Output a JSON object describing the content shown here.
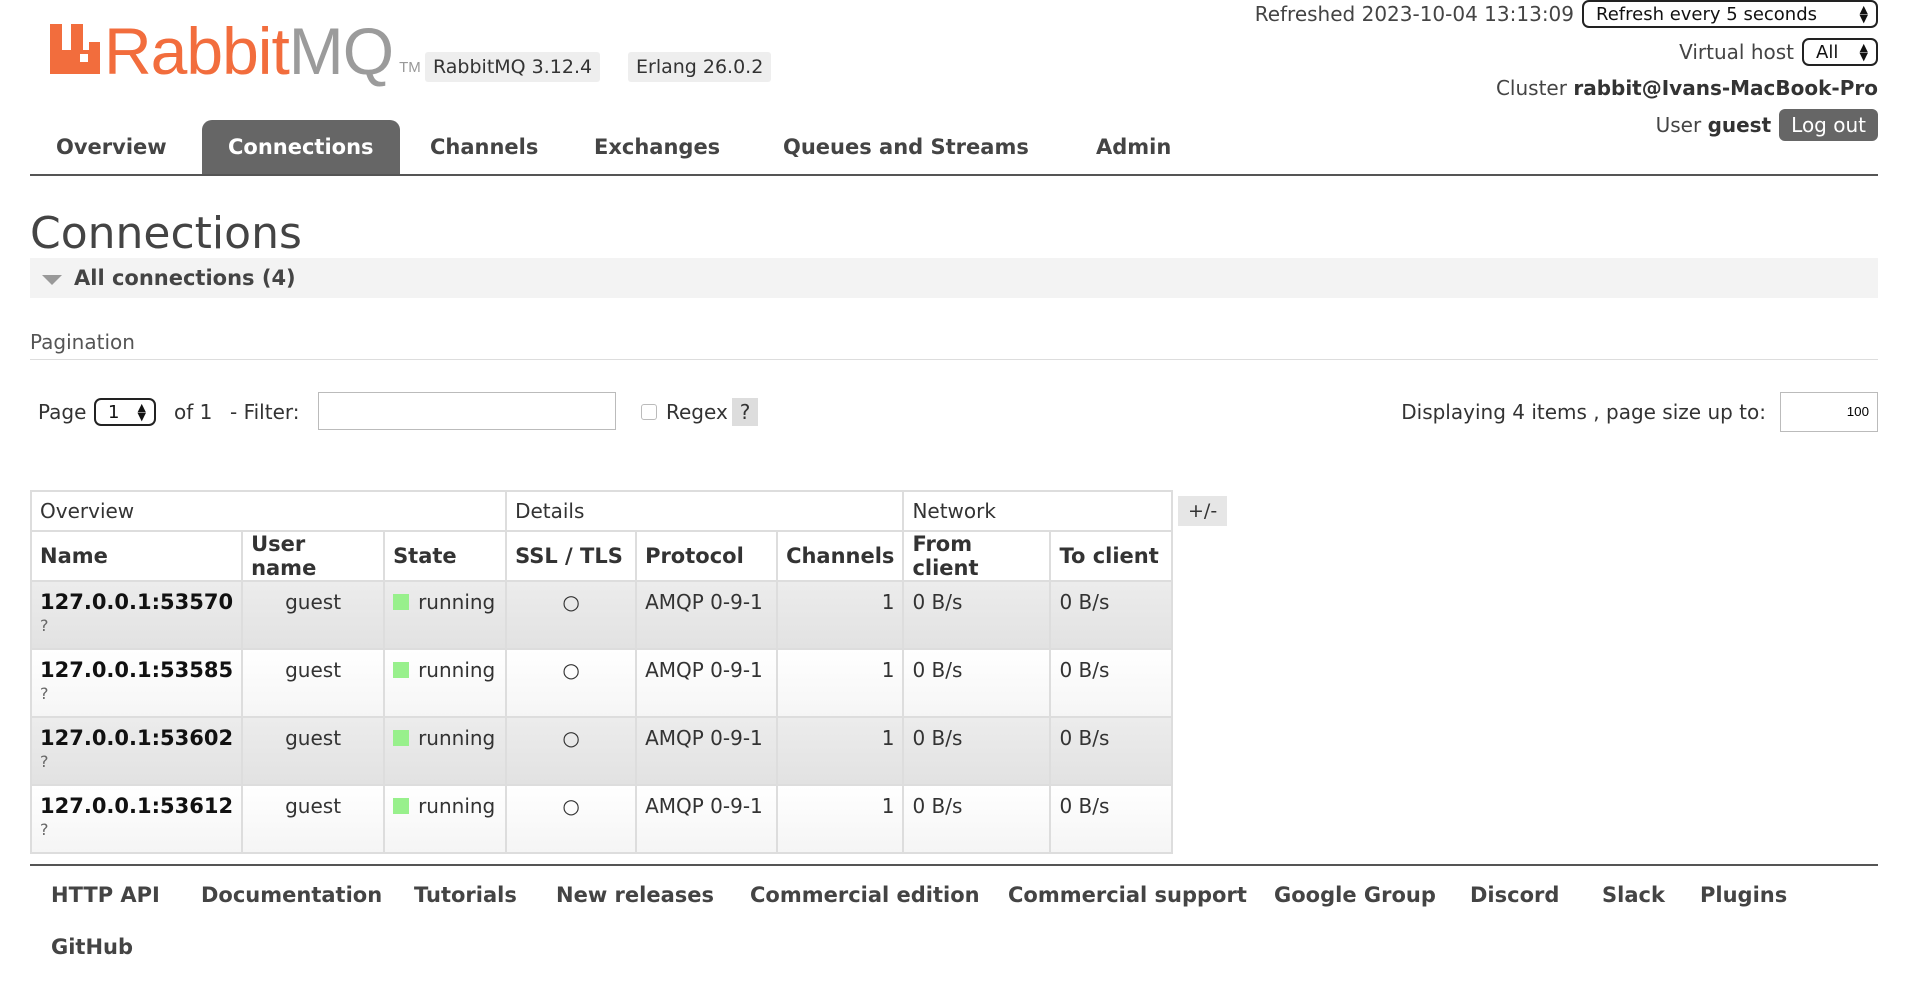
{
  "brand": {
    "name_part1": "Rabbit",
    "name_part2": "MQ",
    "tm": "TM",
    "accent": "#f26d3d"
  },
  "versions": {
    "rabbitmq": "RabbitMQ 3.12.4",
    "erlang": "Erlang 26.0.2"
  },
  "header": {
    "refreshed_label": "Refreshed 2023-10-04 13:13:09",
    "refresh_select": "Refresh every 5 seconds",
    "vhost_label": "Virtual host",
    "vhost_select": "All",
    "cluster_label": "Cluster",
    "cluster_name": "rabbit@Ivans-MacBook-Pro",
    "user_label": "User",
    "user_name": "guest",
    "logout": "Log out"
  },
  "tabs": [
    {
      "label": "Overview",
      "active": false
    },
    {
      "label": "Connections",
      "active": true
    },
    {
      "label": "Channels",
      "active": false
    },
    {
      "label": "Exchanges",
      "active": false
    },
    {
      "label": "Queues and Streams",
      "active": false
    },
    {
      "label": "Admin",
      "active": false
    }
  ],
  "page": {
    "title": "Connections",
    "section": "All connections (4)"
  },
  "pagination": {
    "heading": "Pagination",
    "page_label": "Page",
    "page_value": "1",
    "of_label": "of 1",
    "filter_label": "- Filter:",
    "filter_value": "",
    "regex_label": "Regex",
    "help": "?",
    "displaying": "Displaying 4 items , page size up to:",
    "page_size": "100"
  },
  "table": {
    "groups": [
      "Overview",
      "Details",
      "Network"
    ],
    "columns": [
      "Name",
      "User name",
      "State",
      "SSL / TLS",
      "Protocol",
      "Channels",
      "From client",
      "To client"
    ],
    "plus_minus": "+/-",
    "rows": [
      {
        "name": "127.0.0.1:53570",
        "q": "?",
        "user": "guest",
        "state": "running",
        "ssl": "○",
        "protocol": "AMQP 0-9-1",
        "channels": "1",
        "from": "0 B/s",
        "to": "0 B/s"
      },
      {
        "name": "127.0.0.1:53585",
        "q": "?",
        "user": "guest",
        "state": "running",
        "ssl": "○",
        "protocol": "AMQP 0-9-1",
        "channels": "1",
        "from": "0 B/s",
        "to": "0 B/s"
      },
      {
        "name": "127.0.0.1:53602",
        "q": "?",
        "user": "guest",
        "state": "running",
        "ssl": "○",
        "protocol": "AMQP 0-9-1",
        "channels": "1",
        "from": "0 B/s",
        "to": "0 B/s"
      },
      {
        "name": "127.0.0.1:53612",
        "q": "?",
        "user": "guest",
        "state": "running",
        "ssl": "○",
        "protocol": "AMQP 0-9-1",
        "channels": "1",
        "from": "0 B/s",
        "to": "0 B/s"
      }
    ]
  },
  "footer": {
    "links": [
      "HTTP API",
      "Documentation",
      "Tutorials",
      "New releases",
      "Commercial edition",
      "Commercial support",
      "Google Group",
      "Discord",
      "Slack",
      "Plugins",
      "GitHub"
    ]
  },
  "colors": {
    "state_running": "#98f08c",
    "tab_active": "#666666"
  }
}
